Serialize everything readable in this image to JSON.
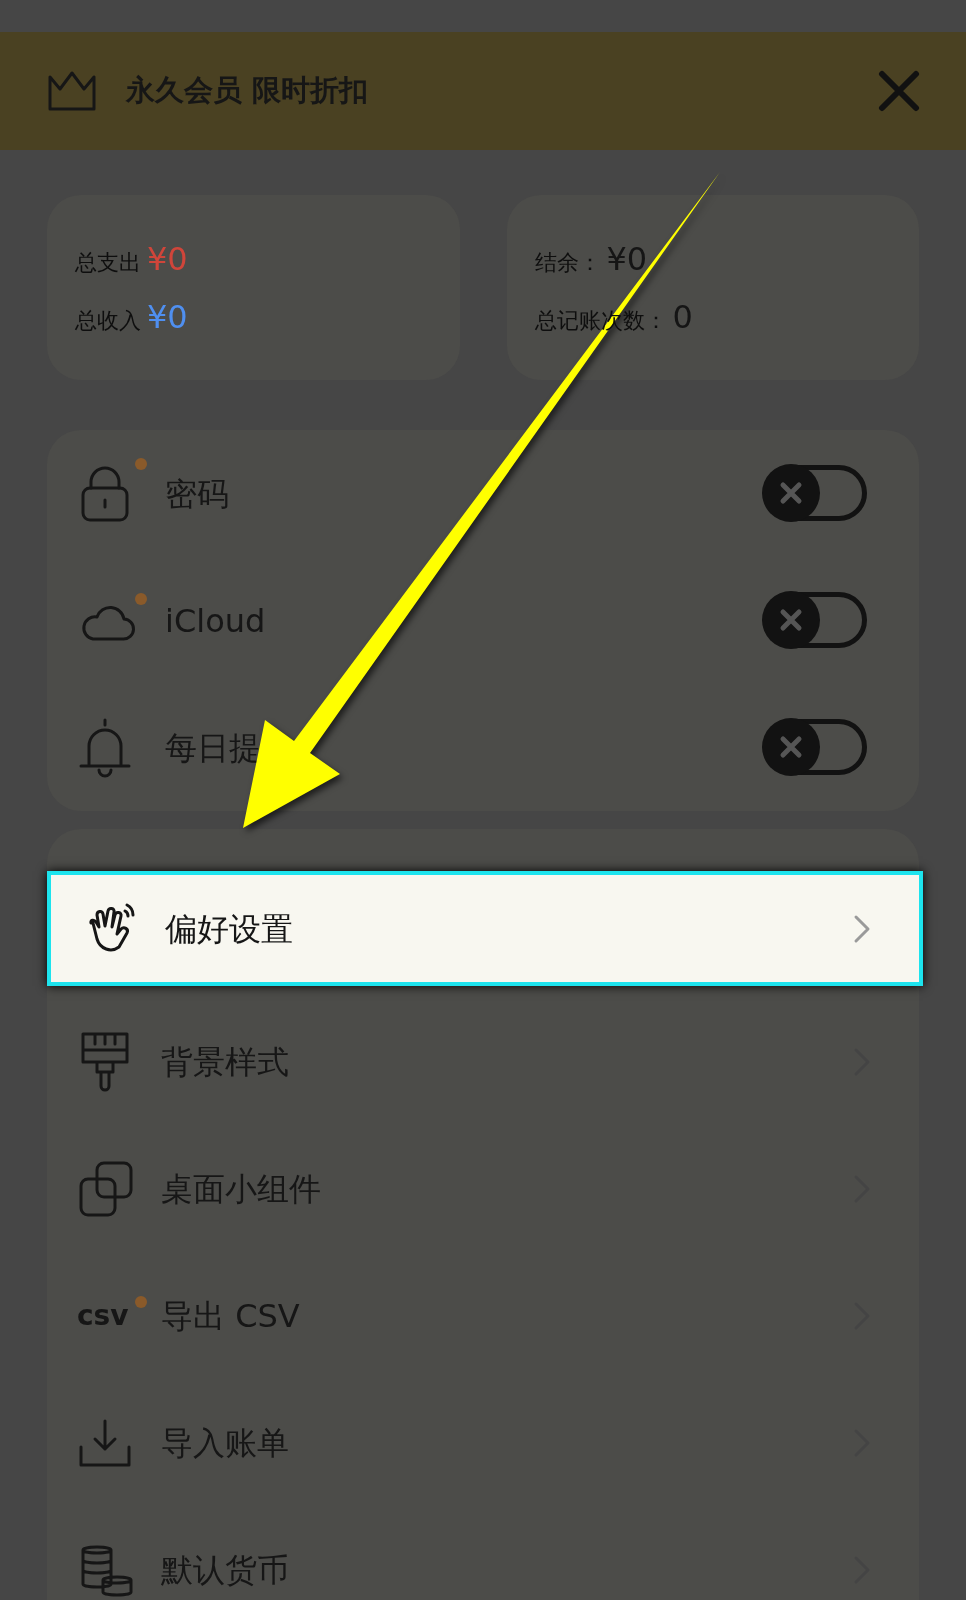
{
  "banner": {
    "title": "永久会员 限时折扣"
  },
  "stats": [
    {
      "items": [
        {
          "label": "总支出",
          "value": "¥0",
          "color": "#d0453a"
        },
        {
          "label": "总收入",
          "value": "¥0",
          "color": "#4f8ff0"
        }
      ]
    },
    {
      "items": [
        {
          "label": "结余：",
          "value": "¥0",
          "color": "#151515"
        },
        {
          "label": "总记账次数：",
          "value": "0",
          "color": "#151515"
        }
      ]
    }
  ],
  "toggles": [
    {
      "label": "密码",
      "kind": "lock",
      "badge": true,
      "on": false
    },
    {
      "label": "iCloud",
      "kind": "cloud",
      "badge": true,
      "on": false
    },
    {
      "label": "每日提",
      "kind": "bell",
      "badge": false,
      "on": false
    }
  ],
  "menu_items": [
    {
      "label": "偏好设置",
      "kind": "hand",
      "badge": false,
      "highlighted": true
    },
    {
      "label": "背景样式",
      "kind": "brush",
      "badge": false,
      "highlighted": false
    },
    {
      "label": "桌面小组件",
      "kind": "copy",
      "badge": false,
      "highlighted": false
    },
    {
      "label": "导出 CSV",
      "kind": "csv",
      "icon_text": "csv",
      "badge": true,
      "highlighted": false
    },
    {
      "label": "导入账单",
      "kind": "download",
      "badge": false,
      "highlighted": false
    },
    {
      "label": "默认货币",
      "kind": "coins",
      "badge": false,
      "highlighted": false
    }
  ]
}
